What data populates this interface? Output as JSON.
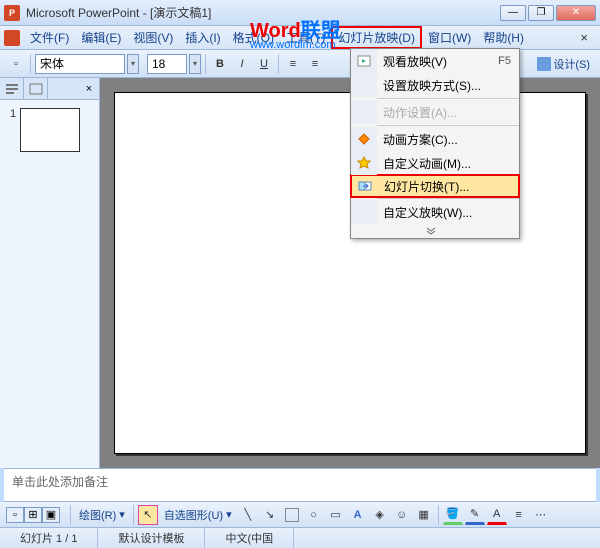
{
  "title": "Microsoft PowerPoint - [演示文稿1]",
  "watermark": {
    "red": "Word",
    "blue": "联盟",
    "url": "www.wordlm.com"
  },
  "menubar": {
    "items": [
      "文件(F)",
      "编辑(E)",
      "视图(V)",
      "插入(I)",
      "格式(O)",
      "工具(T)",
      "幻灯片放映(D)",
      "窗口(W)",
      "帮助(H)"
    ]
  },
  "toolbar": {
    "font": "宋体",
    "size": "18",
    "design": "设计(S)"
  },
  "outline": {
    "slide_num": "1"
  },
  "notes": {
    "placeholder": "单击此处添加备注"
  },
  "drawbar": {
    "draw": "绘图(R)",
    "autoshape": "自选图形(U)"
  },
  "status": {
    "slide": "幻灯片 1 / 1",
    "template": "默认设计模板",
    "lang": "中文(中国"
  },
  "dropdown": {
    "items": [
      {
        "label": "观看放映(V)",
        "shortcut": "F5",
        "icon": "play"
      },
      {
        "label": "设置放映方式(S)...",
        "icon": ""
      },
      {
        "sep": true
      },
      {
        "label": "动作设置(A)...",
        "disabled": true
      },
      {
        "sep": true
      },
      {
        "label": "动画方案(C)...",
        "icon": "scheme"
      },
      {
        "label": "自定义动画(M)...",
        "icon": "custom"
      },
      {
        "label": "幻灯片切换(T)...",
        "icon": "transition",
        "highlight": true
      },
      {
        "sep": true
      },
      {
        "label": "自定义放映(W)..."
      },
      {
        "expand": true
      }
    ]
  }
}
